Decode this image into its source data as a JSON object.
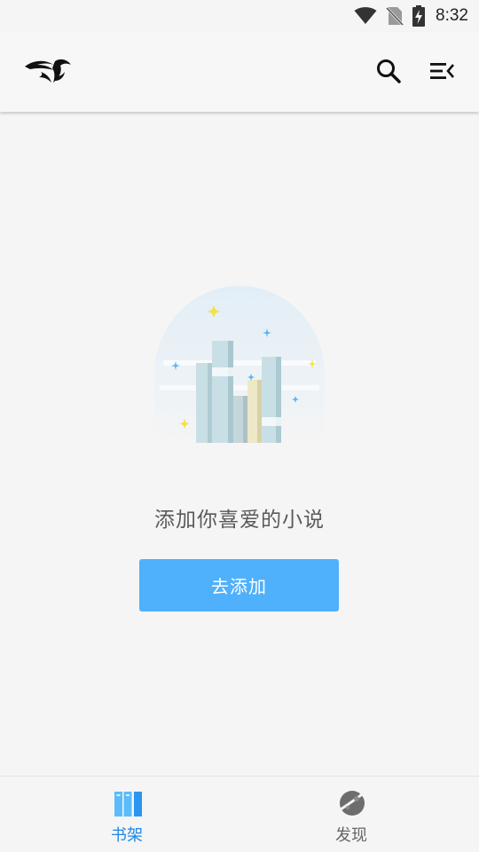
{
  "status_bar": {
    "time": "8:32",
    "icons": [
      "wifi-icon",
      "no-sim-icon",
      "battery-charging-icon"
    ]
  },
  "app_bar": {
    "logo": "bird-logo",
    "actions": [
      "search-icon",
      "menu-collapse-icon"
    ]
  },
  "empty_state": {
    "illustration": "bookshelf-illustration",
    "message": "添加你喜爱的小说",
    "button_label": "去添加"
  },
  "bottom_nav": {
    "items": [
      {
        "label": "书架",
        "icon": "books-icon",
        "active": true
      },
      {
        "label": "发现",
        "icon": "planet-icon",
        "active": false
      }
    ],
    "active_color": "#1e88e5",
    "inactive_color": "#666666"
  },
  "colors": {
    "accent": "#4fb0fb",
    "background": "#f5f5f5"
  }
}
